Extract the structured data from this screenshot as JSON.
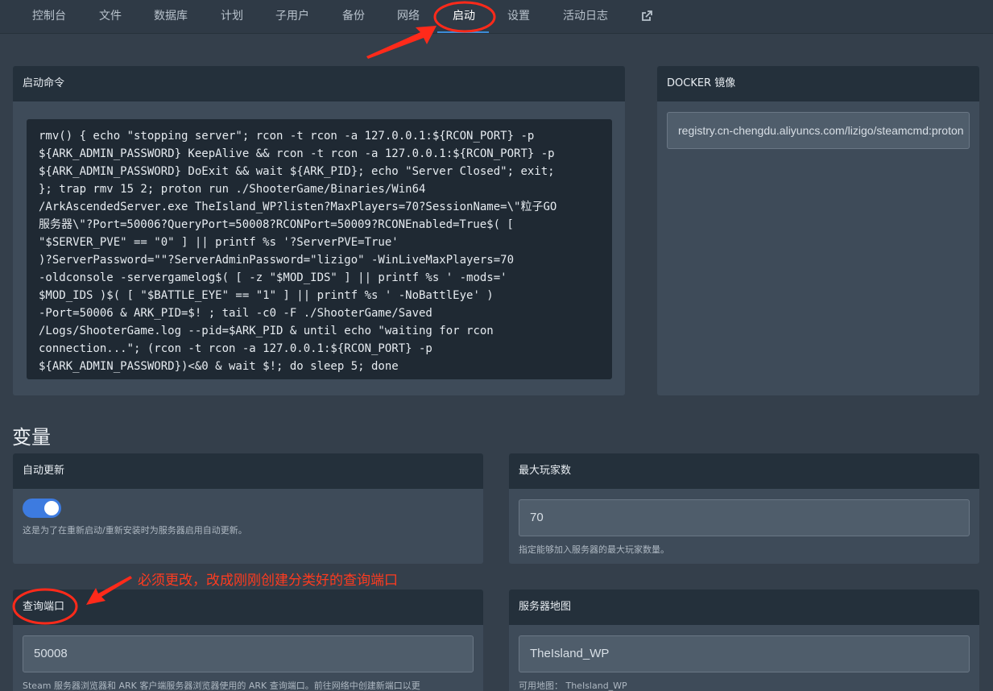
{
  "nav": {
    "items": [
      "控制台",
      "文件",
      "数据库",
      "计划",
      "子用户",
      "备份",
      "网络",
      "启动",
      "设置",
      "活动日志"
    ],
    "active": "启动",
    "external_icon": "external-link-icon"
  },
  "startup": {
    "title": "启动命令",
    "command_lines": [
      "rmv() { echo \"stopping server\"; rcon -t rcon -a 127.0.0.1:${RCON_PORT} -p",
      "${ARK_ADMIN_PASSWORD} KeepAlive && rcon -t rcon -a 127.0.0.1:${RCON_PORT} -p",
      "${ARK_ADMIN_PASSWORD} DoExit && wait ${ARK_PID}; echo \"Server Closed\"; exit;",
      "}; trap rmv 15 2; proton run ./ShooterGame/Binaries/Win64",
      "/ArkAscendedServer.exe TheIsland_WP?listen?MaxPlayers=70?SessionName=\\\"粒子GO",
      "服务器\\\"?Port=50006?QueryPort=50008?RCONPort=50009?RCONEnabled=True$( [",
      "\"$SERVER_PVE\" == \"0\" ] || printf %s '?ServerPVE=True'",
      ")?ServerPassword=\"\"?ServerAdminPassword=\"lizigo\" -WinLiveMaxPlayers=70",
      "-oldconsole -servergamelog$( [ -z \"$MOD_IDS\" ] || printf %s ' -mods='",
      "$MOD_IDS )$( [ \"$BATTLE_EYE\" == \"1\" ] || printf %s ' -NoBattlEye' )",
      "-Port=50006 & ARK_PID=$! ; tail -c0 -F ./ShooterGame/Saved",
      "/Logs/ShooterGame.log --pid=$ARK_PID & until echo \"waiting for rcon",
      "connection...\"; (rcon -t rcon -a 127.0.0.1:${RCON_PORT} -p",
      "${ARK_ADMIN_PASSWORD})<&0 & wait $!; do sleep 5; done"
    ]
  },
  "docker": {
    "title": "DOCKER 镜像",
    "value": "registry.cn-chengdu.aliyuncs.com/lizigo/steamcmd:proton"
  },
  "variables": {
    "title": "变量",
    "auto_update": {
      "title": "自动更新",
      "enabled": true,
      "helper": "这是为了在重新启动/重新安装时为服务器启用自动更新。"
    },
    "max_players": {
      "title": "最大玩家数",
      "value": "70",
      "helper": "指定能够加入服务器的最大玩家数量。"
    },
    "query_port": {
      "title": "查询端口",
      "value": "50008",
      "helper": "Steam 服务器浏览器和 ARK 客户端服务器浏览器使用的 ARK 查询端口。前往网络中创建新端口以更"
    },
    "server_map": {
      "title": "服务器地图",
      "value": "TheIsland_WP",
      "helper": "可用地图： TheIsland_WP"
    }
  },
  "annotation": {
    "text": "必须更改，改成刚刚创建分类好的查询端口",
    "color": "#ff3b1f"
  }
}
